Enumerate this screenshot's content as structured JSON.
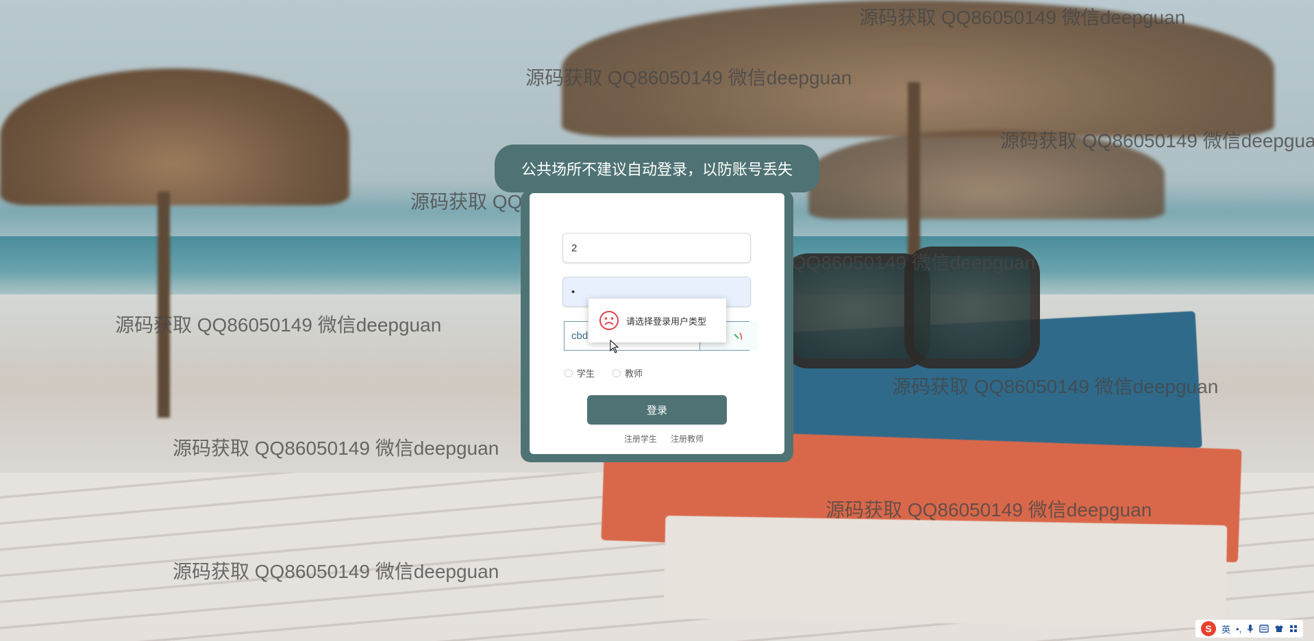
{
  "notice": {
    "text": "公共场所不建议自动登录，以防账号丢失"
  },
  "login_form": {
    "username_value": "2",
    "password_value": "•",
    "captcha_value": "cbd",
    "user_type_options": [
      {
        "label": "学生",
        "selected": false
      },
      {
        "label": "教师",
        "selected": false
      }
    ],
    "login_button": "登录",
    "register_links": [
      "注册学生",
      "注册教师"
    ]
  },
  "toast": {
    "icon": "sad-face-icon",
    "message": "请选择登录用户类型"
  },
  "watermark": {
    "text": "源码获取 QQ86050149 微信deepguan"
  },
  "ime_tray": {
    "logo": "S",
    "language": "英",
    "items": [
      "punctuation-icon",
      "microphone-icon",
      "keyboard-icon",
      "shirt-icon",
      "apps-icon"
    ]
  },
  "colors": {
    "accent": "#4f7374",
    "toast_icon": "#e2424b",
    "autofill": "#e8f0fe"
  }
}
